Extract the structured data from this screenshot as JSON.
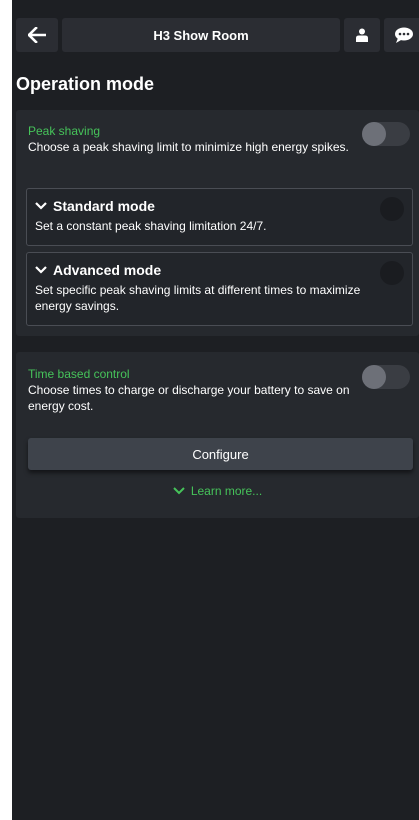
{
  "header": {
    "title": "H3 Show Room",
    "back_icon": "arrow-left-icon",
    "user_icon": "user-icon",
    "chat_icon": "chat-bubble-icon"
  },
  "page": {
    "title": "Operation mode"
  },
  "peak_shaving": {
    "label": "Peak shaving",
    "description": "Choose a peak shaving limit to minimize high energy spikes.",
    "enabled": false,
    "standard": {
      "title": "Standard mode",
      "description": "Set a constant peak shaving limitation 24/7.",
      "selected": false
    },
    "advanced": {
      "title": "Advanced mode",
      "description": "Set specific peak shaving limits at different times to maximize energy savings.",
      "selected": false
    }
  },
  "time_control": {
    "label": "Time based control",
    "description": "Choose times to charge or discharge your battery to save on energy cost.",
    "enabled": false,
    "configure_label": "Configure",
    "learn_more_label": "Learn more..."
  },
  "colors": {
    "accent": "#46c35a",
    "background": "#1d1f23",
    "card": "#26292e"
  }
}
